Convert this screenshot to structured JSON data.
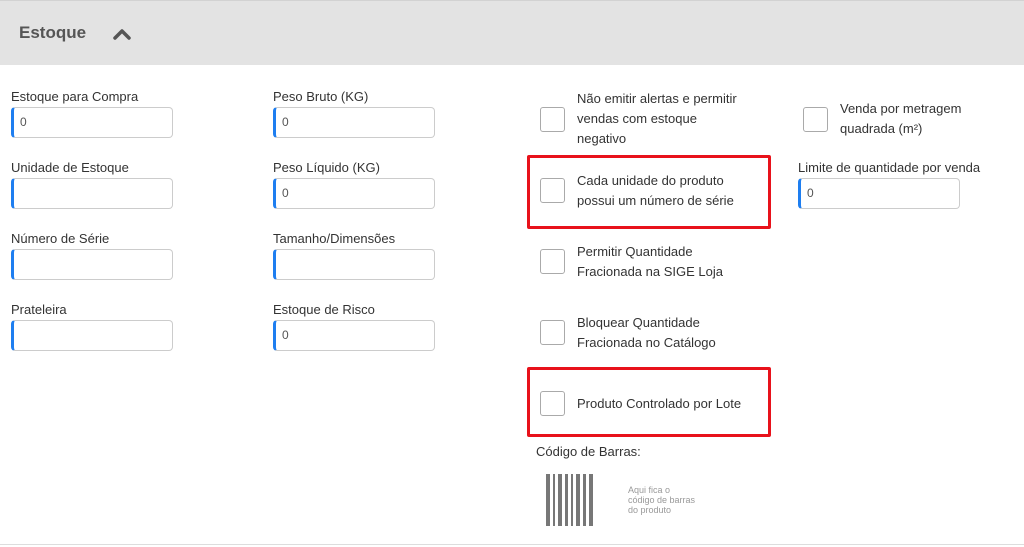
{
  "section": {
    "title": "Estoque",
    "collapse_icon": "chevron-up-icon"
  },
  "col1": [
    {
      "label": "Estoque para Compra",
      "value": "0"
    },
    {
      "label": "Unidade de Estoque",
      "value": ""
    },
    {
      "label": "Número de Série",
      "value": ""
    },
    {
      "label": "Prateleira",
      "value": ""
    }
  ],
  "col2": [
    {
      "label": "Peso Bruto (KG)",
      "value": "0"
    },
    {
      "label": "Peso Líquido (KG)",
      "value": "0"
    },
    {
      "label": "Tamanho/Dimensões",
      "value": ""
    },
    {
      "label": "Estoque de Risco",
      "value": "0"
    }
  ],
  "checks": [
    {
      "lines": [
        "Não emitir alertas e permitir",
        "vendas com estoque",
        "negativo"
      ],
      "checked": false
    },
    {
      "lines": [
        "Cada unidade do produto",
        "possui um número de série"
      ],
      "checked": false,
      "highlighted": true
    },
    {
      "lines": [
        "Permitir Quantidade",
        "Fracionada na SIGE Loja"
      ],
      "checked": false
    },
    {
      "lines": [
        "Bloquear Quantidade",
        "Fracionada no Catálogo"
      ],
      "checked": false
    },
    {
      "lines": [
        "Produto Controlado por Lote"
      ],
      "checked": false,
      "highlighted": true
    }
  ],
  "col4": {
    "venda_metragem": {
      "lines": [
        "Venda por metragem",
        "quadrada (m²)"
      ],
      "checked": false
    },
    "limite": {
      "label": "Limite de quantidade por venda",
      "value": "0"
    }
  },
  "barcode": {
    "label": "Código de Barras:",
    "placeholder_lines": [
      "Aqui fica o",
      "código de barras",
      "do produto"
    ]
  },
  "colors": {
    "accent": "#1e7ef0",
    "highlight": "#e8121b",
    "header_bg": "#e3e3e3"
  }
}
